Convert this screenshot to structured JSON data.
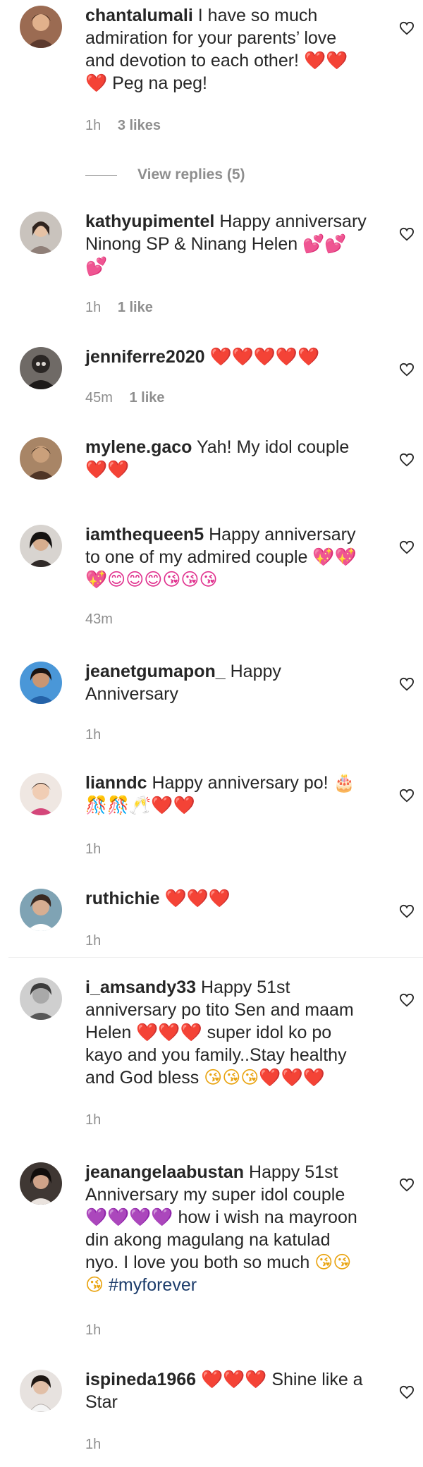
{
  "comments": [
    {
      "username": "chantalumali",
      "text": "I have so much admiration for your parents’ love and devotion to each other!",
      "emoji_after": "❤️❤️❤️",
      "extra": "Peg na peg!",
      "time": "1h",
      "likes": "3 likes"
    },
    {
      "username": "kathyupimentel",
      "text": "Happy anniversary Ninong SP & Ninang Helen",
      "emoji_after": "💕💕💕",
      "time": "1h",
      "likes": "1 like"
    },
    {
      "username": "jenniferre2020",
      "emoji_after": "❤️❤️❤️❤️❤️",
      "time": "45m",
      "likes": "1 like"
    },
    {
      "username": "mylene.gaco",
      "text": "Yah! My idol couple",
      "emoji_after": "❤️❤️"
    },
    {
      "username": "iamthequeen5",
      "text": "Happy anniversary to one of my admired couple",
      "emoji_after": "💖💖💖😊😊😊😘😘😘",
      "time": "43m"
    },
    {
      "username": "jeanetgumapon_",
      "text": "Happy Anniversary",
      "time": "1h"
    },
    {
      "username": "lianndc",
      "text": "Happy anniversary po!",
      "emoji_after": "🎂🎊🎊🥂❤️❤️",
      "time": "1h"
    },
    {
      "username": "ruthichie",
      "emoji_after": "❤️❤️❤️",
      "time": "1h"
    },
    {
      "username": "i_amsandy33",
      "text": "Happy 51st anniversary po tito Sen and maam Helen",
      "emoji_mid": "❤️❤️❤️",
      "text2": "super idol ko po kayo and you family..Stay healthy and God bless",
      "emoji_after": "😘😘😘❤️❤️❤️",
      "time": "1h"
    },
    {
      "username": "jeanangelaabustan",
      "text": "Happy 51st Anniversary my super idol couple",
      "emoji_mid": "💜💜💜💜",
      "text2": "how i wish na mayroon din akong magulang na katulad nyo. I love you both so much",
      "emoji_after": "😘😘😘",
      "hashtag": "#myforever",
      "time": "1h"
    },
    {
      "username": "ispineda1966",
      "emoji_mid": "❤️❤️❤️",
      "text2": "Shine like a Star",
      "time": "1h"
    }
  ],
  "view_replies": "View replies (5)",
  "icons": {
    "like": "heart-outline-icon"
  },
  "colors": {
    "text": "#262626",
    "meta": "#8e8e8e",
    "hashtag": "#1c3c6b"
  }
}
